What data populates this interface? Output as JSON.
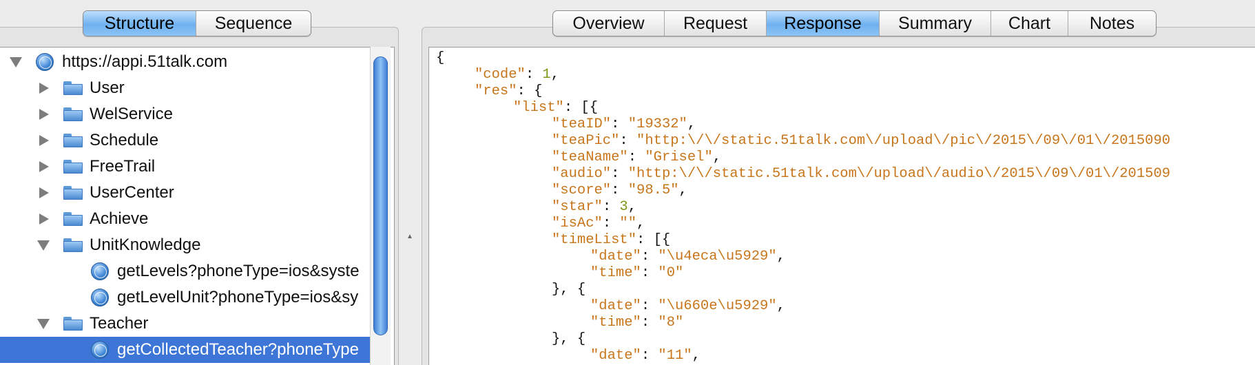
{
  "left_tabs": [
    {
      "label": "Structure",
      "active": true
    },
    {
      "label": "Sequence",
      "active": false
    }
  ],
  "right_tabs": [
    {
      "label": "Overview",
      "active": false
    },
    {
      "label": "Request",
      "active": false
    },
    {
      "label": "Response",
      "active": true
    },
    {
      "label": "Summary",
      "active": false
    },
    {
      "label": "Chart",
      "active": false
    },
    {
      "label": "Notes",
      "active": false
    }
  ],
  "tree": {
    "host": "https://appi.51talk.com",
    "folders": [
      "User",
      "WelService",
      "Schedule",
      "FreeTrail",
      "UserCenter",
      "Achieve"
    ],
    "unit_knowledge": {
      "label": "UnitKnowledge",
      "children": [
        "getLevels?phoneType=ios&syste",
        "getLevelUnit?phoneType=ios&sy"
      ]
    },
    "teacher": {
      "label": "Teacher",
      "children": [
        "getCollectedTeacher?phoneType"
      ]
    }
  },
  "response": {
    "open_brace": "{",
    "code_key": "\"code\"",
    "code_val": "1",
    "res_key": "\"res\"",
    "list_key": "\"list\"",
    "teaID_key": "\"teaID\"",
    "teaID_val": "\"19332\"",
    "teaPic_key": "\"teaPic\"",
    "teaPic_val": "\"http:\\/\\/static.51talk.com\\/upload\\/pic\\/2015\\/09\\/01\\/2015090",
    "teaName_key": "\"teaName\"",
    "teaName_val": "\"Grisel\"",
    "audio_key": "\"audio\"",
    "audio_val": "\"http:\\/\\/static.51talk.com\\/upload\\/audio\\/2015\\/09\\/01\\/201509",
    "score_key": "\"score\"",
    "score_val": "\"98.5\"",
    "star_key": "\"star\"",
    "star_val": "3",
    "isAc_key": "\"isAc\"",
    "isAc_val": "\"\"",
    "timeList_key": "\"timeList\"",
    "date_key": "\"date\"",
    "time_key": "\"time\"",
    "date1_val": "\"\\u4eca\\u5929\"",
    "time1_val": "\"0\"",
    "date2_val": "\"\\u660e\\u5929\"",
    "time2_val": "\"8\"",
    "date3_val": "\"11\""
  },
  "colors": {
    "selection": "#3d76d6",
    "json_key": "#c8761b",
    "json_number": "#7c9a18",
    "tab_active": "#6fb1ef"
  }
}
